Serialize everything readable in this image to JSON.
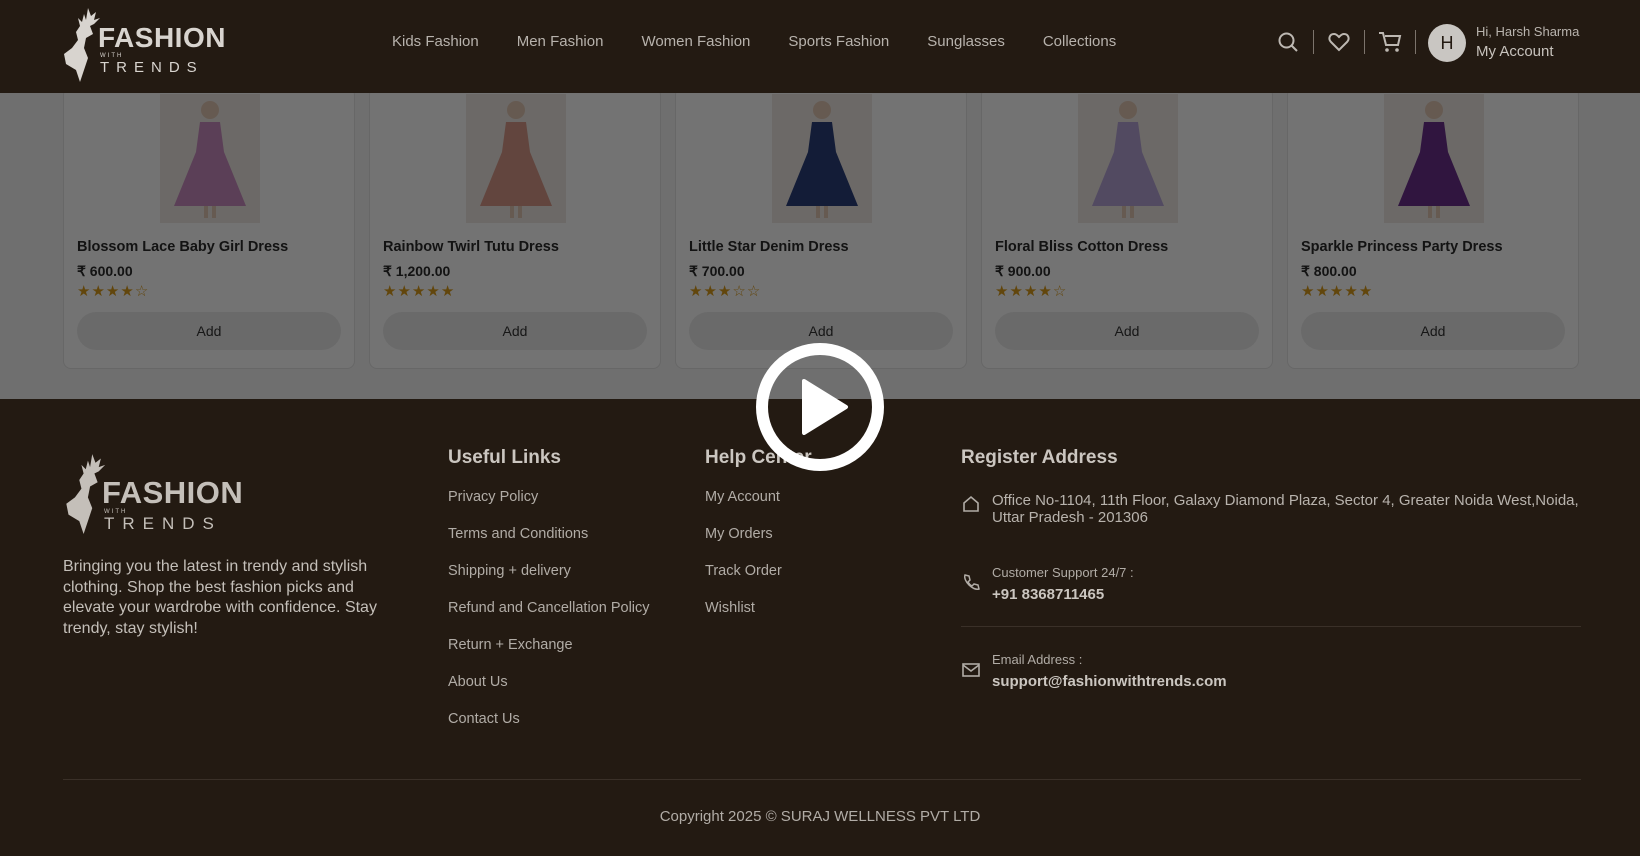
{
  "header": {
    "logo": {
      "word": "FASHION",
      "with": "WITH",
      "trends": "TRENDS"
    },
    "nav": [
      "Kids Fashion",
      "Men Fashion",
      "Women Fashion",
      "Sports Fashion",
      "Sunglasses",
      "Collections"
    ],
    "icons": [
      "search-icon",
      "heart-icon",
      "cart-icon"
    ],
    "account": {
      "avatar_letter": "H",
      "greeting": "Hi, Harsh Sharma",
      "label": "My Account"
    }
  },
  "products": [
    {
      "name": "Blossom Lace Baby Girl Dress",
      "price": "₹ 600.00",
      "rating": 4,
      "button": "Add",
      "dress_color": "#c98cc0"
    },
    {
      "name": "Rainbow Twirl Tutu Dress",
      "price": "₹ 1,200.00",
      "rating": 5,
      "button": "Add",
      "dress_color": "#d99a8a"
    },
    {
      "name": "Little Star Denim Dress",
      "price": "₹ 700.00",
      "rating": 3,
      "button": "Add",
      "dress_color": "#2b3e7a"
    },
    {
      "name": "Floral Bliss Cotton Dress",
      "price": "₹ 900.00",
      "rating": 4,
      "button": "Add",
      "dress_color": "#b6a4d8"
    },
    {
      "name": "Sparkle Princess Party Dress",
      "price": "₹ 800.00",
      "rating": 5,
      "button": "Add",
      "dress_color": "#6a2f8c"
    }
  ],
  "footer": {
    "logo": {
      "word": "FASHION",
      "with": "WITH",
      "trends": "TRENDS"
    },
    "description": "Bringing you the latest in trendy and stylish clothing. Shop the best fashion picks and elevate your wardrobe with confidence. Stay trendy, stay stylish!",
    "useful_links": {
      "title": "Useful Links",
      "items": [
        "Privacy Policy",
        "Terms and Conditions",
        "Shipping + delivery",
        "Refund and Cancellation Policy",
        "Return + Exchange",
        "About Us",
        "Contact Us"
      ]
    },
    "help_center": {
      "title": "Help Center",
      "items": [
        "My Account",
        "My Orders",
        "Track Order",
        "Wishlist"
      ]
    },
    "register": {
      "title": "Register Address",
      "address": "Office No-1104, 11th Floor, Galaxy Diamond Plaza, Sector 4, Greater Noida West,Noida, Uttar Pradesh - 201306",
      "support_label": "Customer Support 24/7 :",
      "support_phone": "+91 8368711465",
      "email_label": "Email Address :",
      "email": "support@fashionwithtrends.com"
    },
    "copyright": "Copyright 2025 © SURAJ WELLNESS PVT LTD"
  },
  "overlay": {
    "icon": "play-icon"
  },
  "colors": {
    "header_bg": "#231a12",
    "star": "#d99b1c",
    "strip_bg": "#f6f6f6"
  }
}
